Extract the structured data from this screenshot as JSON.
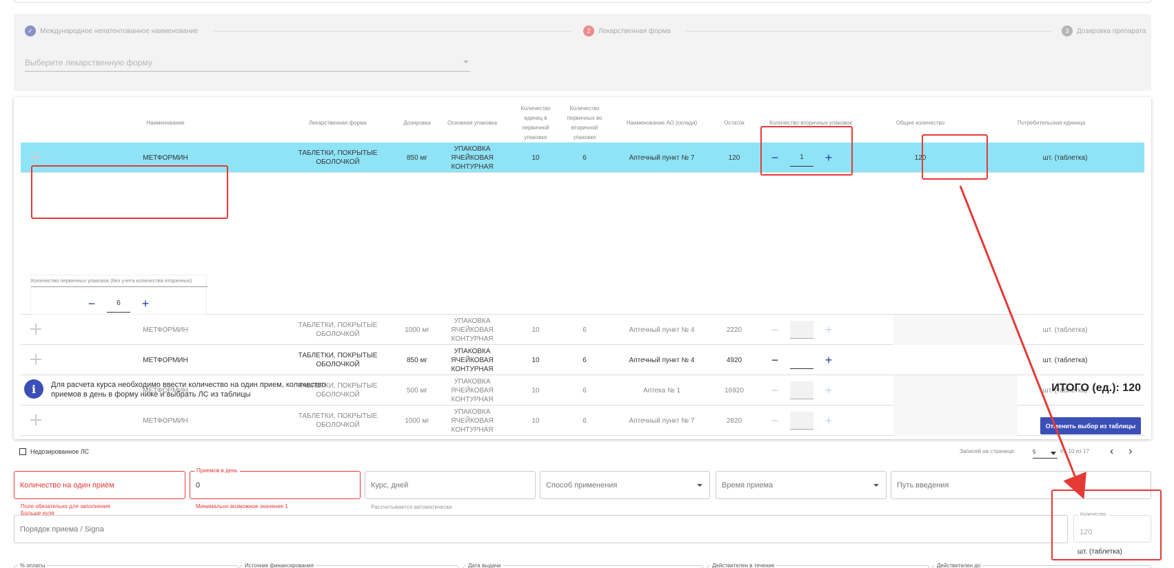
{
  "stepper": {
    "step1": {
      "num": "✓",
      "label": "Международное непатентованное наименование"
    },
    "step2": {
      "num": "2",
      "label": "Лекарственная форма"
    },
    "step3": {
      "num": "3",
      "label": "Дозировка препарата"
    },
    "select_placeholder": "Выберите лекарственную форму"
  },
  "table": {
    "headers": {
      "name": "Наименование",
      "form": "Лекарственная форма",
      "dose": "Дозировка",
      "pack": "Основная упаковка",
      "units": "Количество единиц в первичной упаковке",
      "primary": "Количество первичных во вторичной упаковке",
      "store": "Наименование АО (склада)",
      "stock": "Остаток",
      "secondary": "Количество вторичных упаковок",
      "total": "Общее количество",
      "unit": "Потребительская единица"
    },
    "rows": [
      {
        "name": "МЕТФОРМИН",
        "form": "ТАБЛЕТКИ, ПОКРЫТЫЕ ОБОЛОЧКОЙ",
        "dose": "850 мг",
        "pack": "УПАКОВКА ЯЧЕЙКОВАЯ КОНТУРНАЯ",
        "units": "10",
        "primary": "6",
        "store": "Аптечный пункт № 7",
        "stock": "120",
        "secondary": "1",
        "total": "120",
        "unit": "шт. (таблетка)"
      },
      {
        "name": "МЕТФОРМИН",
        "form": "ТАБЛЕТКИ, ПОКРЫТЫЕ ОБОЛОЧКОЙ",
        "dose": "1000 мг",
        "pack": "УПАКОВКА ЯЧЕЙКОВАЯ КОНТУРНАЯ",
        "units": "10",
        "primary": "6",
        "store": "Аптечный пункт № 4",
        "stock": "2220",
        "secondary": "",
        "total": "",
        "unit": "шт. (таблетка)"
      },
      {
        "name": "МЕТФОРМИН",
        "form": "ТАБЛЕТКИ, ПОКРЫТЫЕ ОБОЛОЧКОЙ",
        "dose": "850 мг",
        "pack": "УПАКОВКА ЯЧЕЙКОВАЯ КОНТУРНАЯ",
        "units": "10",
        "primary": "6",
        "store": "Аптечный пункт № 4",
        "stock": "4920",
        "secondary": "",
        "total": "",
        "unit": "шт. (таблетка)"
      },
      {
        "name": "МЕТФОРМИН",
        "form": "ТАБЛЕТКИ, ПОКРЫТЫЕ ОБОЛОЧКОЙ",
        "dose": "500 мг",
        "pack": "УПАКОВКА ЯЧЕЙКОВАЯ КОНТУРНАЯ",
        "units": "10",
        "primary": "6",
        "store": "Аптека № 1",
        "stock": "16920",
        "secondary": "",
        "total": "",
        "unit": "шт. (таблетка)"
      },
      {
        "name": "МЕТФОРМИН",
        "form": "ТАБЛЕТКИ, ПОКРЫТЫЕ ОБОЛОЧКОЙ",
        "dose": "1000 мг",
        "pack": "УПАКОВКА ЯЧЕЙКОВАЯ КОНТУРНАЯ",
        "units": "10",
        "primary": "6",
        "store": "Аптечный пункт № 7",
        "stock": "2820",
        "secondary": "",
        "total": "",
        "unit": "шт. (таблетка)"
      }
    ],
    "expand": {
      "label": "Количество первичных упаковок (без учета количества вторичных)",
      "value": "6"
    },
    "pager": {
      "per_page_label": "Записей на странице:",
      "per_page": "5",
      "range": "6 - 10 из 17"
    }
  },
  "info": {
    "text": "Для расчета курса необходимо ввести количество на один прием, количество приемов в день в форму ниже и выбрать ЛС из таблицы",
    "total": "ИТОГО (ед.): 120"
  },
  "buttons": {
    "cancel": "Отменить выбор из таблицы"
  },
  "form": {
    "checkbox_label": "Недозированное ЛС",
    "per_dose": {
      "label": "Количество на один приём",
      "hint1": "Поле обязательно для заполнения",
      "hint2": "Больше нуля"
    },
    "per_day": {
      "label": "Приемов в день",
      "value": "0",
      "hint": "Минимально возможное значение 1"
    },
    "course": {
      "label": "Курс, дней",
      "hint": "Рассчитывается автоматически"
    },
    "method": {
      "label": "Способ применения"
    },
    "time": {
      "label": "Время приема"
    },
    "route": {
      "label": "Путь введения"
    },
    "signa": {
      "label": "Порядок приема / Signa"
    },
    "qty": {
      "label": "Количество",
      "value": "120",
      "unit": "шт. (таблетка)"
    },
    "bottom": [
      "% оплаты",
      "Источник финансирования",
      "Дата выдачи",
      "Действителен в течение",
      "Действителен до"
    ]
  },
  "colors": {
    "accent": "#3b4fb8",
    "selected_row": "#8fe3f7",
    "error": "#e53935"
  }
}
